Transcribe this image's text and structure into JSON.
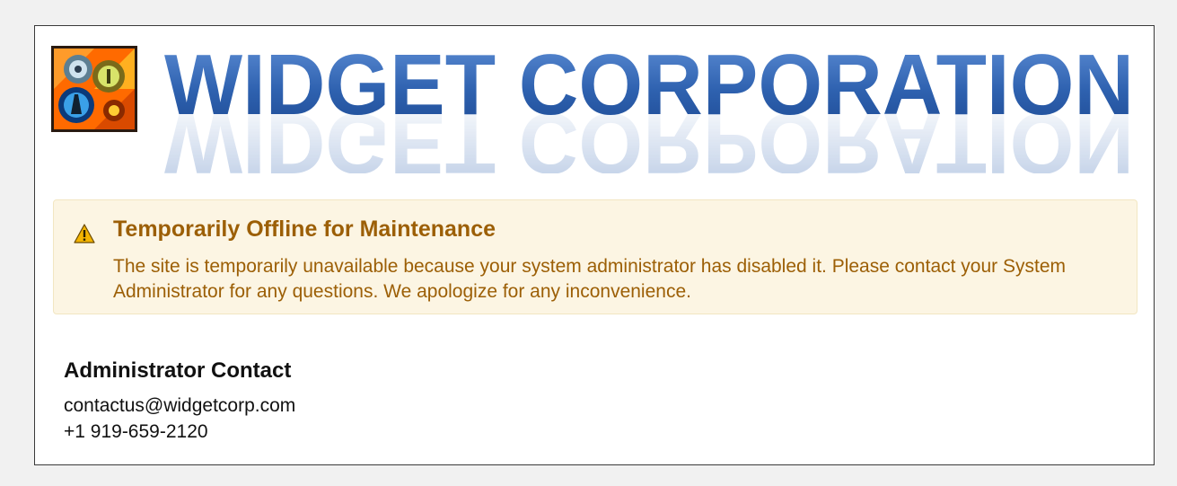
{
  "brand": {
    "name": "WIDGET CORPORATION",
    "logo_icon": "gears-logo-icon"
  },
  "notice": {
    "icon": "warning-triangle-icon",
    "title": "Temporarily Offline for Maintenance",
    "body": "The site is temporarily unavailable because your system administrator has disabled it. Please contact your System Administrator for any questions. We apologize for any inconvenience."
  },
  "contact": {
    "heading": "Administrator Contact",
    "email": "contactus@widgetcorp.com",
    "phone": "+1 919-659-2120"
  },
  "colors": {
    "notice_background": "#fcf5e3",
    "notice_text": "#9c5f06",
    "brand_blue": "#2f62b0"
  }
}
